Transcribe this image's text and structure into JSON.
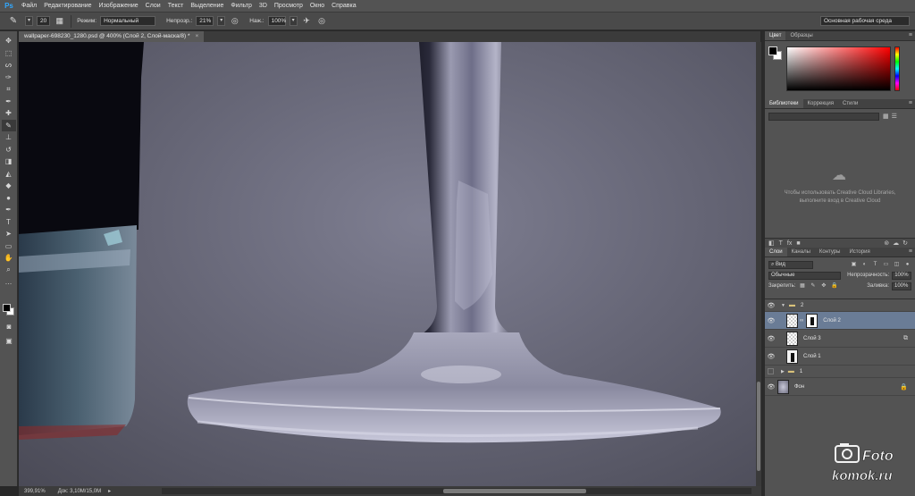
{
  "app": {
    "logo": "Ps"
  },
  "menu": [
    "Файл",
    "Редактирование",
    "Изображение",
    "Слои",
    "Текст",
    "Выделение",
    "Фильтр",
    "3D",
    "Просмотр",
    "Окно",
    "Справка"
  ],
  "options": {
    "brush_size": "20",
    "mode_label": "Режим:",
    "mode_value": "Нормальный",
    "opacity_label": "Непрозр.:",
    "opacity_value": "21%",
    "flow_label": "Наж.:",
    "flow_value": "100%",
    "workspace": "Основная рабочая среда"
  },
  "document": {
    "tab_title": "wallpaper-698230_1280.psd @ 400% (Слой 2, Слой-маска/8) *",
    "zoom": "399,91%",
    "doc_size": "Док: 3,10M/15,0M"
  },
  "panels": {
    "color_tabs": [
      "Цвет",
      "Образцы"
    ],
    "library_tabs": [
      "Библиотеки",
      "Коррекция",
      "Стили"
    ],
    "cc_message": "Чтобы использовать Creative Cloud Libraries, выполните вход в Creative Cloud",
    "layers_tabs": [
      "Слои",
      "Каналы",
      "Контуры",
      "История"
    ],
    "filter_kind": "Вид",
    "blend_mode": "Обычные",
    "opacity_label": "Непрозрачность:",
    "opacity_value": "100%",
    "lock_label": "Закрепить:",
    "fill_label": "Заливка:",
    "fill_value": "100%"
  },
  "layers": [
    {
      "name": "2",
      "type": "group",
      "visible": true
    },
    {
      "name": "Слой 2",
      "type": "layer",
      "visible": true,
      "selected": true
    },
    {
      "name": "Слой 3",
      "type": "layer",
      "visible": true
    },
    {
      "name": "Слой 1",
      "type": "layer",
      "visible": true
    },
    {
      "name": "1",
      "type": "group",
      "visible": false
    },
    {
      "name": "Фон",
      "type": "background",
      "visible": true
    }
  ],
  "watermark": {
    "line1": "Foto",
    "line2": "komok.ru"
  }
}
